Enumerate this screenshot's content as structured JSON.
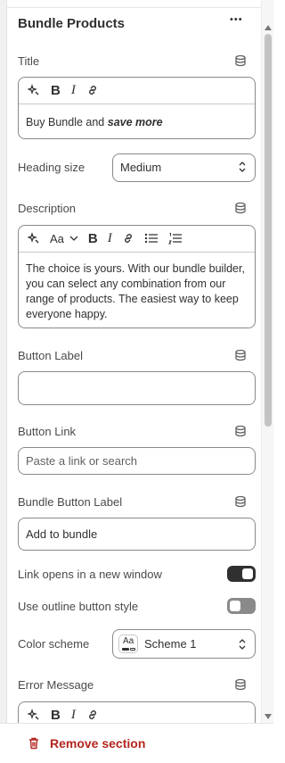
{
  "section": {
    "title": "Bundle Products",
    "more_glyph": "•••"
  },
  "title_field": {
    "label": "Title",
    "value_plain": "Buy Bundle and ",
    "value_emph": "save more"
  },
  "heading_size": {
    "label": "Heading size",
    "value": "Medium"
  },
  "description": {
    "label": "Description",
    "font_label": "Aa",
    "value": "The choice is yours. With our bundle builder, you can select any combination from our range of products. The easiest way to keep everyone happy."
  },
  "button_label": {
    "label": "Button Label",
    "value": ""
  },
  "button_link": {
    "label": "Button Link",
    "placeholder": "Paste a link or search"
  },
  "bundle_button_label": {
    "label": "Bundle Button Label",
    "value": "Add to bundle"
  },
  "new_window": {
    "label": "Link opens in a new window",
    "checked": true
  },
  "outline_style": {
    "label": "Use outline button style",
    "checked": false
  },
  "color_scheme": {
    "label": "Color scheme",
    "swatch_text": "Aa",
    "value": "Scheme 1"
  },
  "error_message": {
    "label": "Error Message"
  },
  "toolbar": {
    "bold": "B",
    "italic": "I"
  },
  "footer": {
    "remove_label": "Remove section"
  },
  "colors": {
    "danger": "#b3261e",
    "toggle_on": "#303030",
    "toggle_off": "#8a8a8a"
  }
}
